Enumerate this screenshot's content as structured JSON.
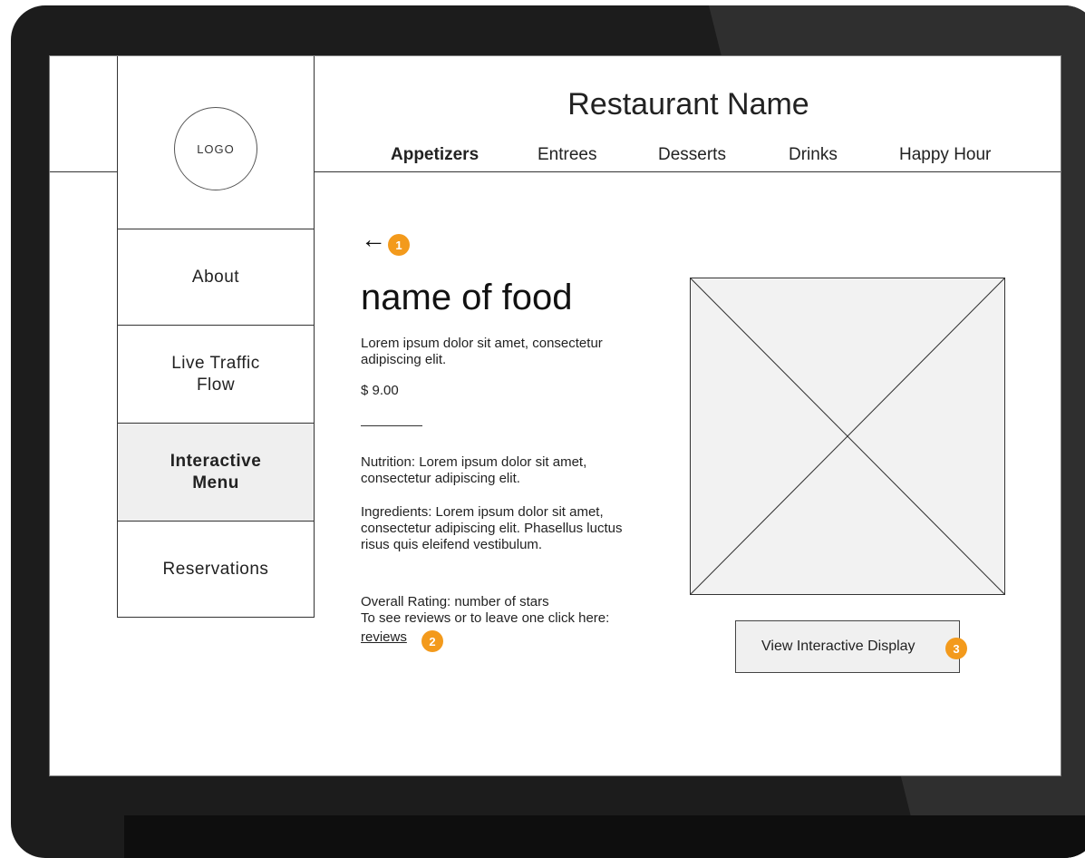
{
  "restaurant_name": "Restaurant Name",
  "logo_text": "LOGO",
  "tabs": [
    {
      "label": "Appetizers",
      "active": true
    },
    {
      "label": "Entrees"
    },
    {
      "label": "Desserts"
    },
    {
      "label": "Drinks"
    },
    {
      "label": "Happy Hour"
    }
  ],
  "sidebar": {
    "items": [
      {
        "label": "About"
      },
      {
        "label": "Live Traffic\nFlow"
      },
      {
        "label": "Interactive\nMenu",
        "active": true
      },
      {
        "label": "Reservations"
      }
    ]
  },
  "back_arrow": "←",
  "badges": [
    "1",
    "2",
    "3"
  ],
  "badge_color": "#f39a1c",
  "food": {
    "name": "name of food",
    "description": "Lorem ipsum dolor sit amet, consectetur adipiscing elit.",
    "price": "$ 9.00",
    "nutrition": "Nutrition: Lorem ipsum dolor sit amet, consectetur adipiscing elit.",
    "ingredients": "Ingredients: Lorem ipsum dolor sit amet, consectetur adipiscing elit. Phasellus luctus risus quis eleifend vestibulum.",
    "rating": "Overall Rating: number of stars",
    "reviews_prompt": "To see reviews or to leave one click here:",
    "reviews_link": "reviews"
  },
  "display_button": "View Interactive Display"
}
